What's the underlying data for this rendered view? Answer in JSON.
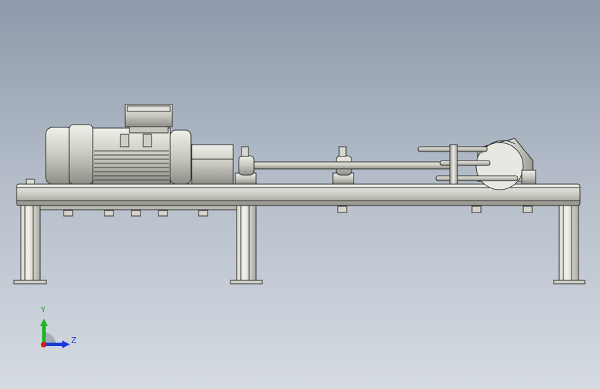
{
  "triad": {
    "y_label": "Y",
    "z_label": "Z",
    "colors": {
      "y_axis": "#22b422",
      "z_axis": "#1a39d8",
      "x_axis": "#d11a1a",
      "y_label": "#2a8f2a",
      "z_label": "#1a39d8"
    }
  },
  "colors": {
    "background_top": "#8d9aab",
    "background_bottom": "#d6dbe2",
    "metal_light": "#e6e6df",
    "metal_mid": "#c9c9c0",
    "metal_dark": "#8e8e87",
    "edge": "#2b2b2b"
  }
}
